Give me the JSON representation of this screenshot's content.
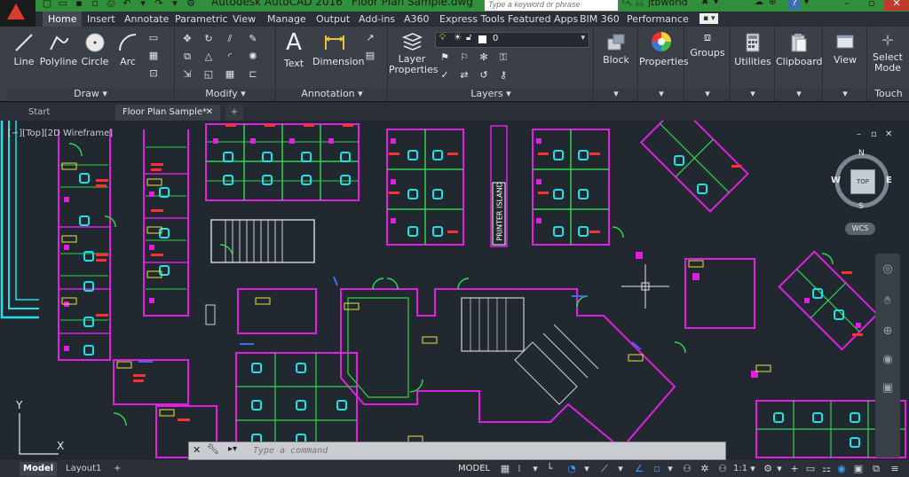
{
  "title_bar": {
    "app_title": "Autodesk AutoCAD 2016",
    "file_title": "Floor Plan Sample.dwg",
    "search_placeholder": "Type a keyword or phrase",
    "user": "jtbworld",
    "help": "?"
  },
  "ribbon_tabs": [
    "Home",
    "Insert",
    "Annotate",
    "Parametric",
    "View",
    "Manage",
    "Output",
    "Add-ins",
    "A360",
    "Express Tools",
    "Featured Apps",
    "BIM 360",
    "Performance"
  ],
  "ribbon": {
    "draw": {
      "label": "Draw ▾",
      "tools": [
        "Line",
        "Polyline",
        "Circle",
        "Arc"
      ]
    },
    "modify": {
      "label": "Modify ▾"
    },
    "annotation": {
      "label": "Annotation ▾",
      "tools": [
        "Text",
        "Dimension"
      ]
    },
    "layers": {
      "label": "Layers ▾",
      "tool_line1": "Layer",
      "tool_line2": "Properties",
      "current_layer": "0"
    },
    "block": "Block",
    "properties": "Properties",
    "groups": "Groups",
    "utilities": "Utilities",
    "clipboard": "Clipboard",
    "view": "View",
    "select_line1": "Select",
    "select_line2": "Mode",
    "touch": "Touch"
  },
  "doc_tabs": {
    "start": "Start",
    "active": "Floor Plan Sample*",
    "add": "+"
  },
  "viewport": {
    "label": "[−][Top][2D Wireframe]"
  },
  "viewcube": {
    "top": "TOP",
    "n": "N",
    "w": "W",
    "e": "E",
    "s": "S",
    "wcs": "WCS"
  },
  "canvas_text": {
    "printer_island": "PRINTER ISLAND",
    "ucs_y": "Y",
    "ucs_x": "X"
  },
  "command_line": {
    "placeholder": "Type a command"
  },
  "status_bar": {
    "layout_tabs": [
      "Model",
      "Layout1"
    ],
    "add": "+",
    "model_button": "MODEL",
    "scale": "1:1"
  },
  "colors": {
    "title_bar": "#2f8f3a",
    "ribbon_bg": "#3b4048",
    "canvas_bg": "#212830",
    "magenta": "#e020e0",
    "cyan": "#19e3e6",
    "green": "#2fd64a",
    "yellow": "#e8e23a",
    "red": "#ff3030"
  }
}
